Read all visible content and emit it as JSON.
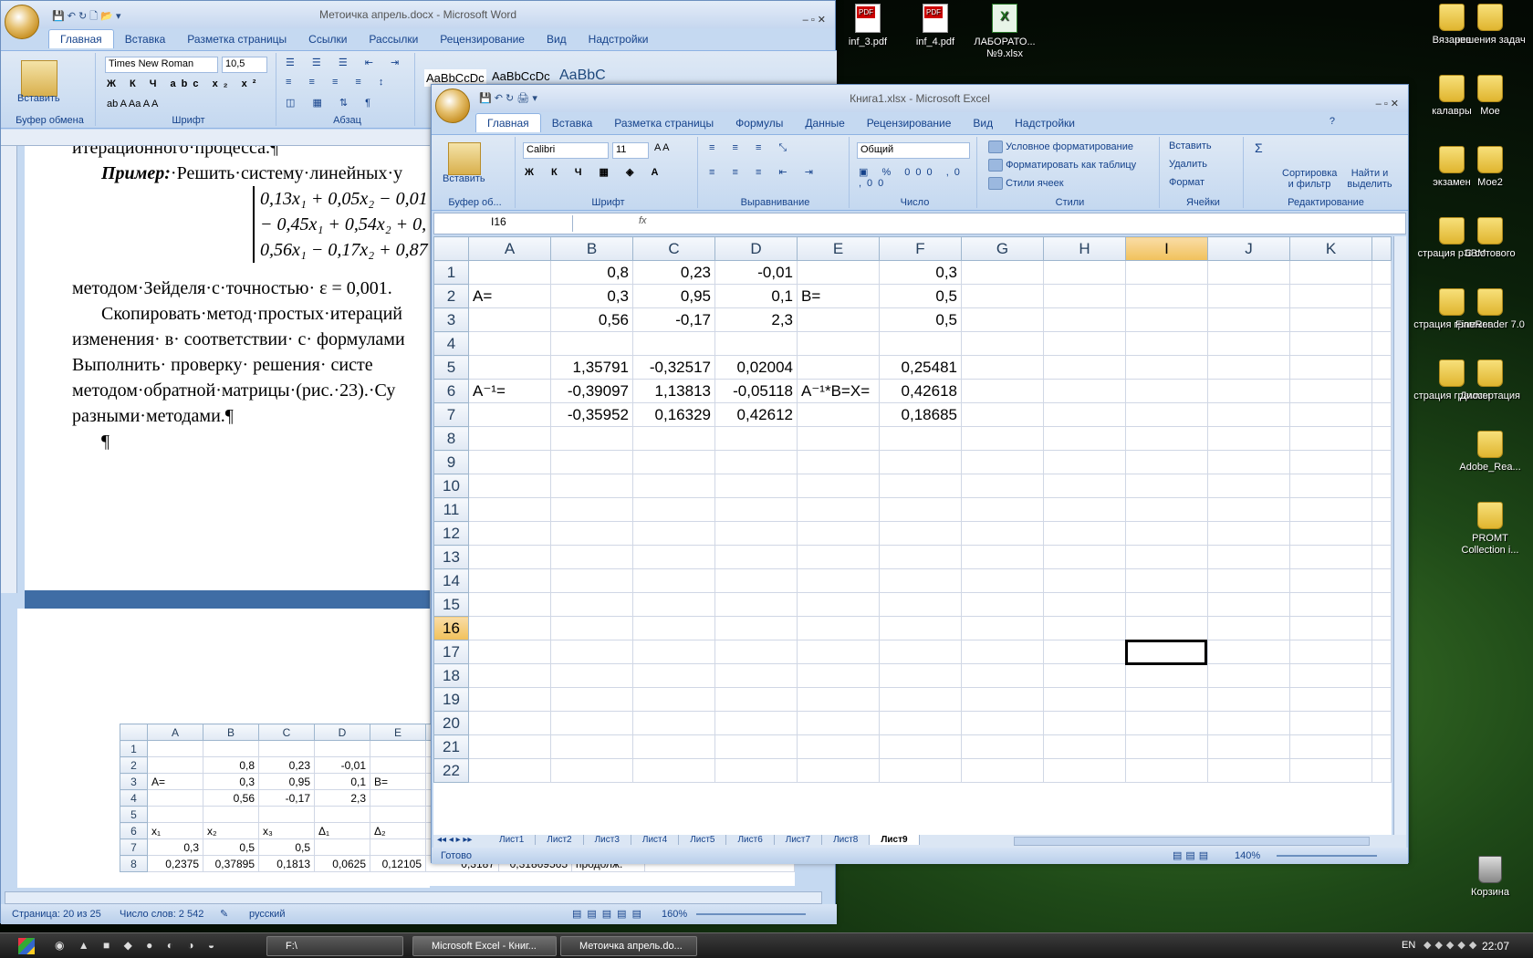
{
  "desktop": {
    "top_icons": [
      {
        "label": "inf_3.pdf",
        "type": "pdf"
      },
      {
        "label": "inf_4.pdf",
        "type": "pdf"
      },
      {
        "label": "ЛАБОРАТО... №9.xlsx",
        "type": "xls"
      }
    ],
    "right_col1": [
      "Вязание",
      "калавры",
      "экзамен",
      "страция рЭВМ",
      "страция граммы",
      "страция граммы"
    ],
    "right_col2": [
      "решения задач",
      "Мое",
      "Мое2",
      "С сотового",
      "FineReader 7.0",
      "Диссертация",
      "Adobe_Rea...",
      "PROMT Collection i..."
    ],
    "recycle": "Корзина"
  },
  "word": {
    "title": "Метоичка апрель.docx - Microsoft Word",
    "tabs": [
      "Главная",
      "Вставка",
      "Разметка страницы",
      "Ссылки",
      "Рассылки",
      "Рецензирование",
      "Вид",
      "Надстройки"
    ],
    "font": "Times New Roman",
    "size": "10,5",
    "paste": "Вставить",
    "groups": [
      "Буфер обмена",
      "Шрифт",
      "Абзац"
    ],
    "styles": [
      "AaBbCcDc",
      "AaBbCcDc",
      "AaBbC"
    ],
    "doc_lines": [
      "итерационного·процесса.¶",
      "·Решить·систему·линейных·у",
      "методом·Зейделя·с·точностью· ε = 0,001.",
      "Скопировать·метод·простых·итераций",
      "изменения· в· соответствии· с· формулами",
      "Выполнить·  проверку·  решения·  систе",
      "методом·обратной·матрицы·(рис.·23).·Су",
      "разными·методами.¶",
      "¶"
    ],
    "example_label": "Пример:",
    "eq": [
      "0,13x₁ + 0,05x₂ − 0,01",
      "− 0,45x₁ + 0,54x₂ + 0,",
      "0,56x₁ − 0,17x₂ + 0,87"
    ],
    "embedded": {
      "cols": [
        "A",
        "B",
        "C",
        "D",
        "E"
      ],
      "rows": [
        [
          "1",
          "",
          "",
          "",
          "",
          ""
        ],
        [
          "2",
          "",
          "0,8",
          "0,23",
          "-0,01",
          ""
        ],
        [
          "3",
          "A=",
          "0,3",
          "0,95",
          "0,1",
          "B="
        ],
        [
          "4",
          "",
          "0,56",
          "-0,17",
          "2,3",
          ""
        ],
        [
          "5",
          "",
          "",
          "",
          "",
          ""
        ],
        [
          "6",
          "x₁",
          "x₂",
          "x₃",
          "Δ₁",
          "Δ₂"
        ],
        [
          "7",
          "0,3",
          "0,5",
          "0,5",
          "",
          ""
        ],
        [
          "8",
          "0,2375",
          "0,37895",
          "0,1813",
          "0,0625",
          "0,12105"
        ]
      ],
      "row8_extra": [
        "0,3187",
        "0,31869565",
        "продолж."
      ]
    },
    "status": {
      "page": "Страница: 20 из 25",
      "words": "Число слов: 2 542",
      "lang": "русский",
      "zoom": "160%"
    }
  },
  "excel": {
    "title": "Книга1.xlsx - Microsoft Excel",
    "tabs": [
      "Главная",
      "Вставка",
      "Разметка страницы",
      "Формулы",
      "Данные",
      "Рецензирование",
      "Вид",
      "Надстройки"
    ],
    "font": "Calibri",
    "size": "11",
    "number_format": "Общий",
    "paste": "Вставить",
    "groups": [
      "Буфер об...",
      "Шрифт",
      "Выравнивание",
      "Число",
      "Стили",
      "Ячейки",
      "Редактирование"
    ],
    "styles_items": [
      "Условное форматирование",
      "Форматировать как таблицу",
      "Стили ячеек"
    ],
    "cells_items": [
      "Вставить",
      "Удалить",
      "Формат"
    ],
    "edit_items": [
      "Сортировка и фильтр",
      "Найти и выделить"
    ],
    "name_box": "I16",
    "fx": "fx",
    "columns": [
      "A",
      "B",
      "C",
      "D",
      "E",
      "F",
      "G",
      "H",
      "I",
      "J",
      "K"
    ],
    "rows": [
      [
        "1",
        "",
        "0,8",
        "0,23",
        "-0,01",
        "",
        "0,3"
      ],
      [
        "2",
        "A=",
        "0,3",
        "0,95",
        "0,1",
        "B=",
        "0,5"
      ],
      [
        "3",
        "",
        "0,56",
        "-0,17",
        "2,3",
        "",
        "0,5"
      ],
      [
        "4",
        "",
        "",
        "",
        "",
        "",
        ""
      ],
      [
        "5",
        "",
        "1,35791",
        "-0,32517",
        "0,02004",
        "",
        "0,25481"
      ],
      [
        "6",
        "A⁻¹=",
        "-0,39097",
        "1,13813",
        "-0,05118",
        "A⁻¹*B=X=",
        "0,42618"
      ],
      [
        "7",
        "",
        "-0,35952",
        "0,16329",
        "0,42612",
        "",
        "0,18685"
      ]
    ],
    "empty_rows": [
      "8",
      "9",
      "10",
      "11",
      "12",
      "13",
      "14",
      "15",
      "16",
      "17",
      "18",
      "19",
      "20",
      "21",
      "22"
    ],
    "sheets": [
      "Лист1",
      "Лист2",
      "Лист3",
      "Лист4",
      "Лист5",
      "Лист6",
      "Лист7",
      "Лист8",
      "Лист9"
    ],
    "status": "Готово",
    "zoom": "140%"
  },
  "taskbar": {
    "items": [
      "F:\\",
      "Microsoft Excel - Книг...",
      "Метоичка апрель.do..."
    ],
    "lang": "EN",
    "clock": "22:07"
  }
}
